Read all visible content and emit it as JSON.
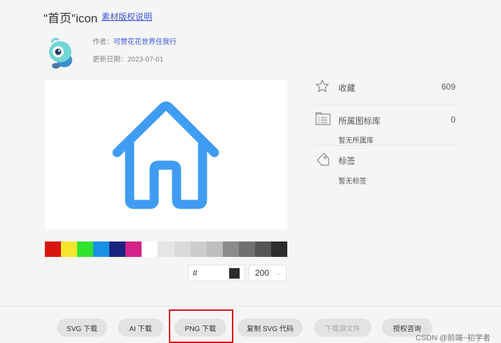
{
  "header": {
    "title": "\"首页\"icon",
    "license_link": "素材版权说明"
  },
  "author": {
    "label": "作者：",
    "name": "可赞花花世界任我行",
    "date_label": "更新日期：",
    "date": "2023-07-01",
    "avatar_icon": "mascot-avatar-icon"
  },
  "preview": {
    "icon": "home-icon",
    "icon_color": "#3f9cf2",
    "background": "#ffffff"
  },
  "palette": {
    "colors": [
      "#d7170f",
      "#f5e52c",
      "#31e32f",
      "#1991e7",
      "#192480",
      "#d3228a",
      "#ffffff",
      "#e5e5e5",
      "#dadada",
      "#cdcdcd",
      "#bfbfbf",
      "#8b8b8b",
      "#707070",
      "#555555",
      "#2d2d2d"
    ]
  },
  "controls": {
    "hex_prefix": "#",
    "hex_value": "",
    "current_color": "#2b2b2b",
    "size_value": "200"
  },
  "info": {
    "favorite_label": "收藏",
    "favorite_count": "609",
    "library_label": "所属图标库",
    "library_count": "0",
    "library_empty": "暂无所属库",
    "tags_label": "标签",
    "tags_empty": "暂无标签"
  },
  "buttons": {
    "svg_download": "SVG 下载",
    "ai_download": "AI 下载",
    "png_download": "PNG 下载",
    "copy_svg": "复制 SVG 代码",
    "download_source": "下载源文件",
    "license_consult": "授权咨询"
  },
  "watermark": "CSDN @前端~初学者"
}
